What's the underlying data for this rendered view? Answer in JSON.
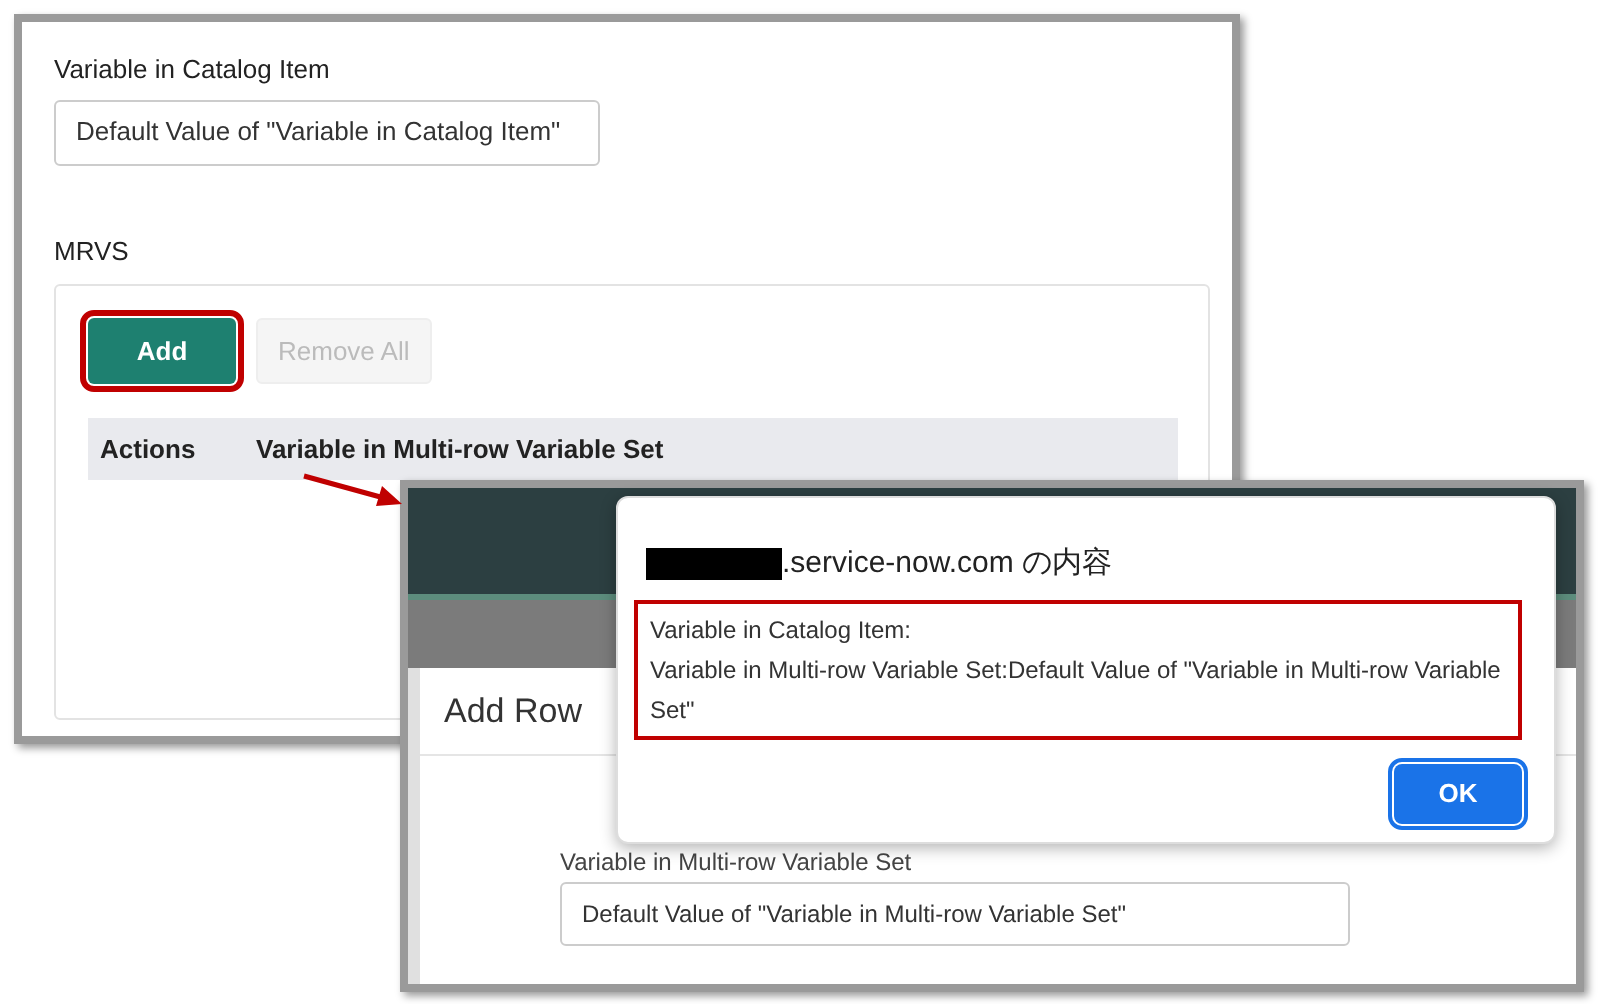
{
  "catalog_form": {
    "label": "Variable in Catalog Item",
    "field_value": "Default Value of \"Variable in Catalog Item\"",
    "mrvs_label": "MRVS",
    "buttons": [
      {
        "label": "Add",
        "disabled": false
      },
      {
        "label": "Remove All",
        "disabled": true
      }
    ],
    "table_columns": [
      "Actions",
      "Variable in Multi-row Variable Set"
    ]
  },
  "add_row_modal": {
    "title": "Add Row",
    "field_label": "Variable in Multi-row Variable Set",
    "field_value": "Default Value of \"Variable in Multi-row Variable Set\""
  },
  "alert": {
    "title": ".service-now.com の内容",
    "message_lines": [
      "Variable in Catalog Item:",
      "Variable in Multi-row Variable Set:Default Value of \"Variable in Multi-row Variable Set\""
    ],
    "ok": "OK"
  }
}
